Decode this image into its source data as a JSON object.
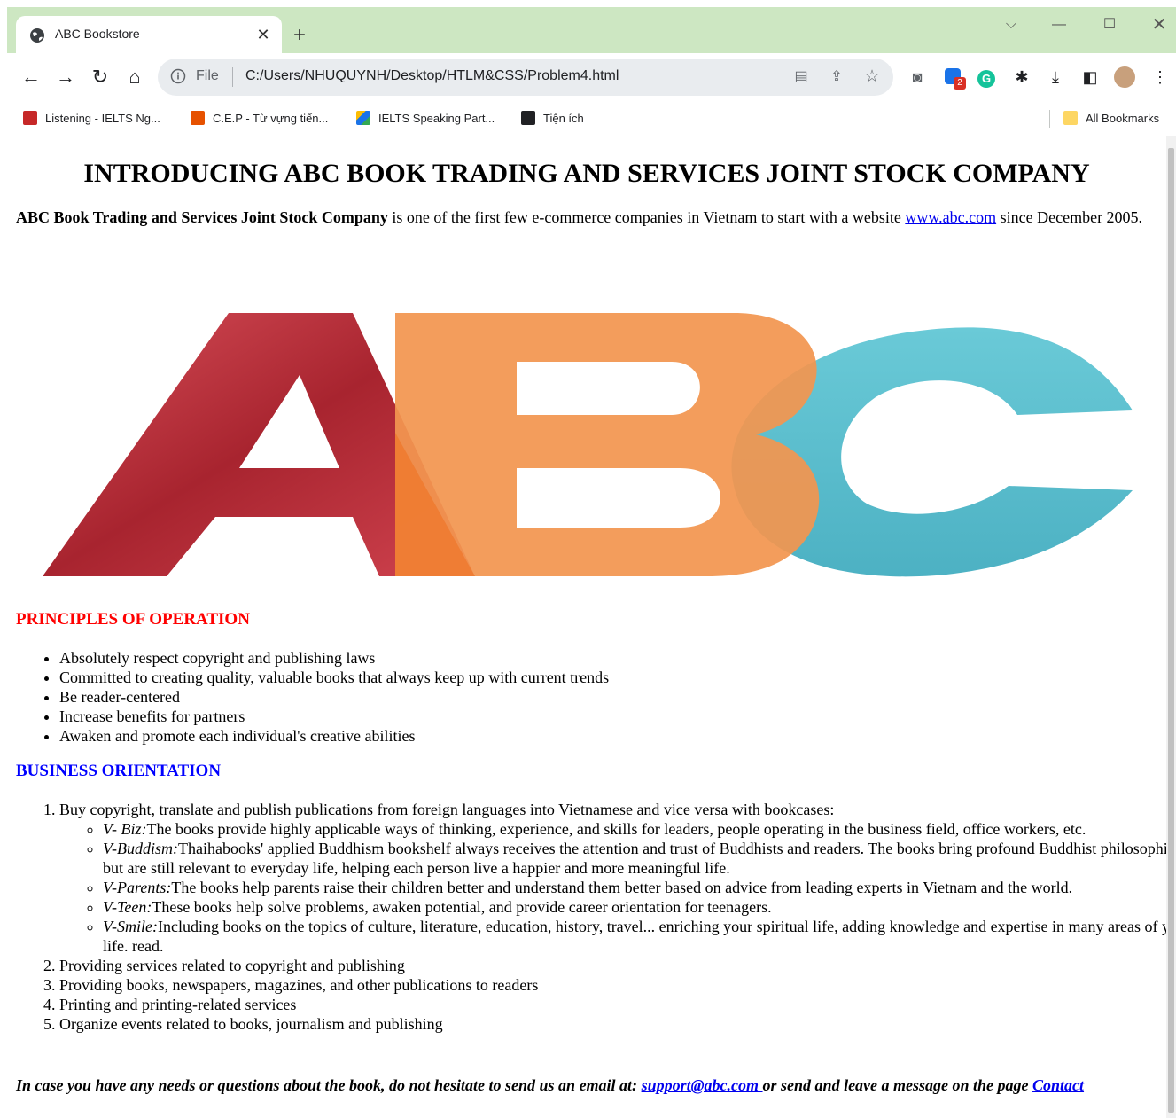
{
  "browser": {
    "tab_title": "ABC Bookstore",
    "url_scheme": "File",
    "url": "C:/Users/NHUQUYNH/Desktop/HTLM&CSS/Problem4.html",
    "extension_badge": "2",
    "bookmarks": [
      {
        "label": "Listening - IELTS Ng...",
        "icon": "ielts-favicon",
        "color": "#c62828"
      },
      {
        "label": "C.E.P - Từ vựng tiến...",
        "icon": "cep-favicon",
        "color": "#e65100"
      },
      {
        "label": "IELTS Speaking Part...",
        "icon": "drive-icon",
        "color": "#1a73e8"
      },
      {
        "label": "Tiện ích",
        "icon": "puzzle-icon",
        "color": "#202124"
      }
    ],
    "all_bookmarks": "All Bookmarks"
  },
  "page": {
    "heading": "INTRODUCING ABC BOOK TRADING AND SERVICES JOINT STOCK COMPANY",
    "intro": {
      "company": "ABC Book Trading and Services Joint Stock Company",
      "text_before_link": " is one of the first few e-commerce companies in Vietnam to start with a website ",
      "link": "www.abc.com",
      "text_after_link": " since December 2005."
    },
    "logo": {
      "letters": "ABC",
      "colors": {
        "a": "#d0434f",
        "b": "#f29650",
        "c": "#4ab7c8"
      }
    },
    "principles": {
      "heading": "PRINCIPLES OF OPERATION",
      "heading_color": "#ff0000",
      "items": [
        "Absolutely respect copyright and publishing laws",
        "Committed to creating quality, valuable books that always keep up with current trends",
        "Be reader-centered",
        "Increase benefits for partners",
        "Awaken and promote each individual's creative abilities"
      ]
    },
    "business": {
      "heading": "BUSINESS ORIENTATION",
      "heading_color": "#0000ff",
      "item1": "Buy copyright, translate and publish publications from foreign languages into Vietnamese and vice versa with bookcases:",
      "bookcases": [
        {
          "name": "V- Biz:",
          "desc": "The books provide highly applicable ways of thinking, experience, and skills for leaders, people operating in the business field, office workers, etc."
        },
        {
          "name": "V-Buddism:",
          "desc": "Thaihabooks' applied Buddhism bookshelf always receives the attention and trust of Buddhists and readers. The books bring profound Buddhist philosophies but are still relevant to everyday life, helping each person live a happier and more meaningful life."
        },
        {
          "name": "V-Parents:",
          "desc": "The books help parents raise their children better and understand them better based on advice from leading experts in Vietnam and the world."
        },
        {
          "name": "V-Teen:",
          "desc": "These books help solve problems, awaken potential, and provide career orientation for teenagers."
        },
        {
          "name": "V-Smile:",
          "desc": "Including books on the topics of culture, literature, education, history, travel... enriching your spiritual life, adding knowledge and expertise in many areas of your life. read."
        }
      ],
      "items": [
        "Providing services related to copyright and publishing",
        "Providing books, newspapers, magazines, and other publications to readers",
        "Printing and printing-related services",
        "Organize events related to books, journalism and publishing"
      ]
    },
    "footer": {
      "text_before_email": "In case you have any needs or questions about the book, do not hesitate to send us an email at: ",
      "email": "support@abc.com ",
      "text_middle": "or send and leave a message on the page ",
      "contact": "Contact"
    }
  }
}
